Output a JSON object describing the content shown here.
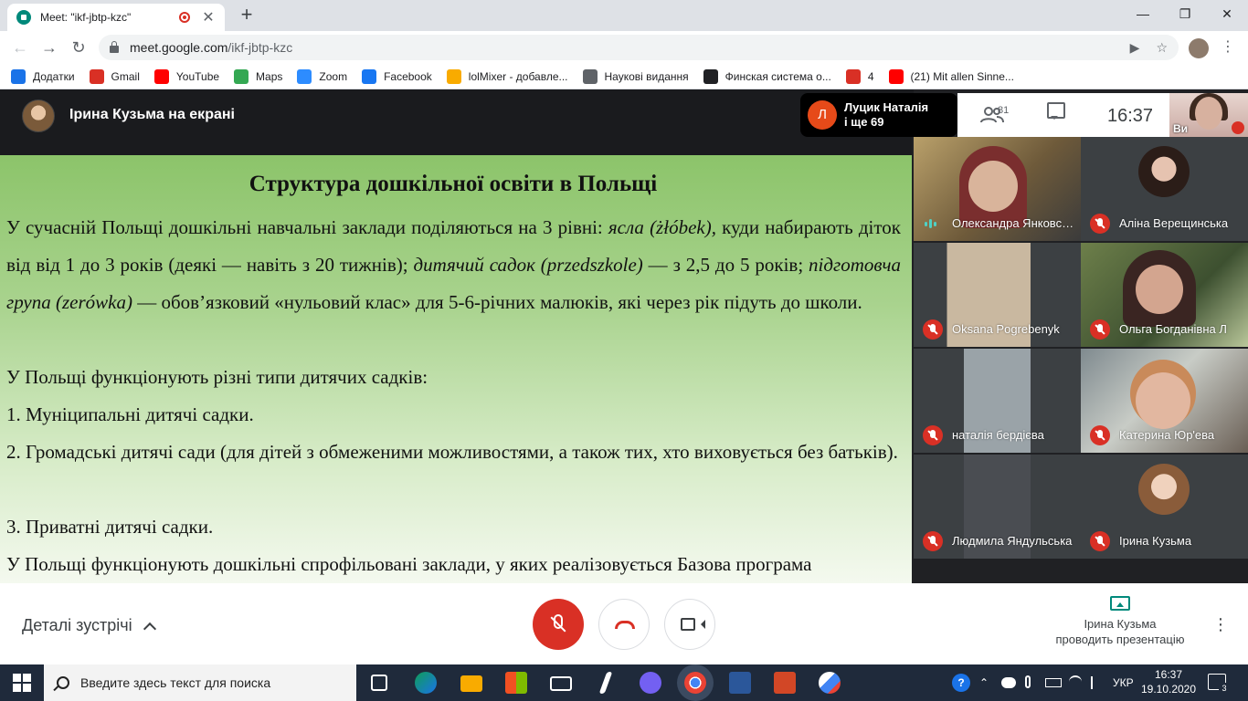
{
  "browser": {
    "tab_title": "Meet: \"ikf-jbtp-kzc\"",
    "tab_close": "✕",
    "new_tab": "+",
    "window_controls": {
      "minimize": "—",
      "maximize": "❐",
      "close": "✕"
    },
    "nav": {
      "back": "←",
      "forward": "→",
      "reload": "↻"
    },
    "url_host": "meet.google.com",
    "url_path": "/ikf-jbtp-kzc",
    "omnibox_icons": {
      "camera": "▶",
      "star": "☆"
    },
    "menu": "⋮"
  },
  "bookmarks": [
    {
      "label": "Додатки",
      "icon": "apps-grid-icon",
      "color": "#1a73e8"
    },
    {
      "label": "Gmail",
      "icon": "gmail-icon",
      "color": "#d93025"
    },
    {
      "label": "YouTube",
      "icon": "youtube-icon",
      "color": "#ff0000"
    },
    {
      "label": "Maps",
      "icon": "maps-pin-icon",
      "color": "#34a853"
    },
    {
      "label": "Zoom",
      "icon": "zoom-icon",
      "color": "#2d8cff"
    },
    {
      "label": "Facebook",
      "icon": "facebook-icon",
      "color": "#1877f2"
    },
    {
      "label": "lolMixer - добавле...",
      "icon": "cat-icon",
      "color": "#f9ab00"
    },
    {
      "label": "Наукові видання",
      "icon": "journal-icon",
      "color": "#5f6368"
    },
    {
      "label": "Финская система о...",
      "icon": "book-icon",
      "color": "#202124"
    },
    {
      "label": "4",
      "icon": "k-icon",
      "color": "#d93025"
    },
    {
      "label": "(21) Mit allen Sinne...",
      "icon": "youtube-icon",
      "color": "#ff0000"
    }
  ],
  "meet": {
    "presenting_label": "Ірина Кузьма на екрані",
    "speaker_initial": "Л",
    "speaker_name_line1": "Луцик Наталія",
    "speaker_name_line2": "і ще 69",
    "people_count": "81",
    "clock": "16:37",
    "self_label": "Ви",
    "accent_red": "#d93025",
    "slide": {
      "title": "Структура дошкільної освіти в Польщі",
      "p1_a": "У сучасній Польщі дошкільні навчальні заклади поділяються на 3 рівні: ",
      "p1_b": "ясла (żłóbek),",
      "p1_c": " куди набирають діток від від 1 до 3 років (деякі — навіть з 20 тижнів); ",
      "p1_d": "дитячий садок (przedszkole)",
      "p1_e": " — з 2,5 до 5 років; ",
      "p1_f": "підготовча група (zerówka)",
      "p1_g": " — обов’язковий «нульовий клас» для 5-6-річних малюків, які через рік підуть до школи.",
      "p2": "У Польщі функціонують різні типи дитячих садків:",
      "p3": "1. Муніципальні дитячі садки.",
      "p4": "2. Громадські дитячі сади (для дітей з обмеженими можливостями, а також тих, хто виховується без батьків).",
      "p5": "3. Приватні дитячі садки.",
      "p6": "У Польщі функціонують дошкільні спрофільовані заклади, у яких реалізовується  Базова програма"
    },
    "participants": [
      {
        "name": "Олександра Янковська",
        "state": "talking"
      },
      {
        "name": "Аліна Верещинська",
        "state": "muted"
      },
      {
        "name": "Oksana Pogrebenyk",
        "state": "muted"
      },
      {
        "name": "Ольга Богданівна Л",
        "state": "muted"
      },
      {
        "name": "наталія бердієва",
        "state": "muted"
      },
      {
        "name": "Катерина Юр'ева",
        "state": "muted"
      },
      {
        "name": "Людмила Яндульська",
        "state": "muted"
      },
      {
        "name": "Ірина Кузьма",
        "state": "muted"
      }
    ]
  },
  "controls": {
    "details_label": "Деталі зустрічі",
    "presenter_line1": "Ірина Кузьма",
    "presenter_line2": "проводить презентацію",
    "more": "⋮"
  },
  "taskbar": {
    "search_placeholder": "Введите здесь текст для поиска",
    "language": "УКР",
    "time": "16:37",
    "date": "19.10.2020",
    "notification_count": "3",
    "help_glyph": "?",
    "tray_up": "⌃"
  }
}
